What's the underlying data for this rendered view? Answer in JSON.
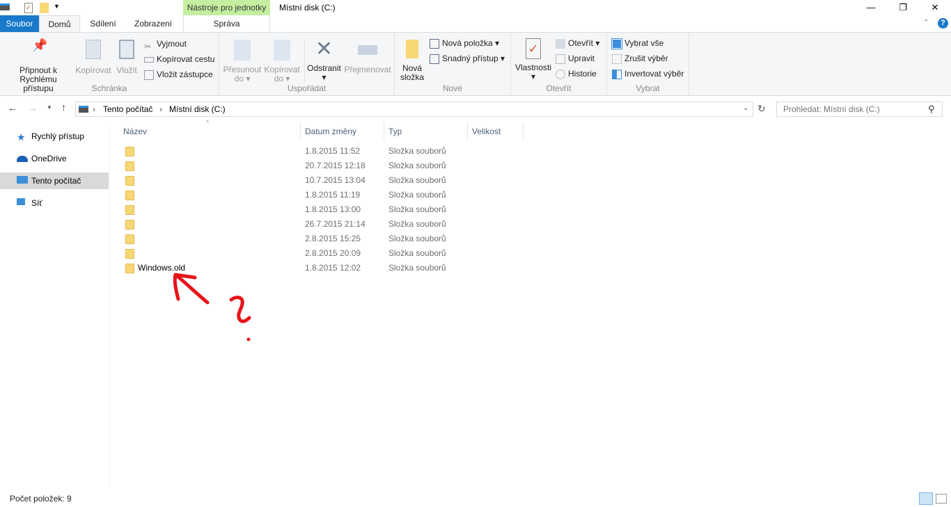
{
  "window": {
    "title": "Místní disk (C:)",
    "context_tab": "Nástroje pro jednotky",
    "minimize": "—",
    "restore": "❐",
    "close": "✕"
  },
  "tabs": {
    "file": "Soubor",
    "home": "Domů",
    "share": "Sdílení",
    "view": "Zobrazení",
    "manage": "Správa"
  },
  "ribbon": {
    "clipboard": {
      "label": "Schránka",
      "pin": "Připnout k",
      "pin2": "Rychlému přístupu",
      "copy": "Kopírovat",
      "paste": "Vložit",
      "cut": "Vyjmout",
      "copy_path": "Kopírovat cestu",
      "paste_shortcut": "Vložit zástupce"
    },
    "organize": {
      "label": "Uspořádat",
      "move": "Přesunout",
      "move2": "do",
      "copy": "Kopírovat",
      "copy2": "do",
      "delete": "Odstranit",
      "rename": "Přejmenovat"
    },
    "new": {
      "label": "Nové",
      "new_folder": "Nová",
      "new_folder2": "složka",
      "new_item": "Nová položka",
      "easy_access": "Snadný přístup"
    },
    "open": {
      "label": "Otevřít",
      "properties": "Vlastnosti",
      "open": "Otevřít",
      "edit": "Upravit",
      "history": "Historie"
    },
    "select": {
      "label": "Vybrat",
      "all": "Vybrat vše",
      "none": "Zrušit výběr",
      "invert": "Invertovat výběr"
    }
  },
  "address": {
    "crumbs": [
      "Tento počítač",
      "Místní disk (C:)"
    ],
    "search_placeholder": "Prohledat: Místní disk (C:)"
  },
  "nav": [
    {
      "label": "Rychlý přístup",
      "color": "#2b7cd3"
    },
    {
      "label": "OneDrive",
      "color": "#1a5fb4"
    },
    {
      "label": "Tento počítač",
      "color": "#3b8fd8"
    },
    {
      "label": "Síť",
      "color": "#3b8fd8"
    }
  ],
  "columns": {
    "name": "Název",
    "date": "Datum změny",
    "type": "Typ",
    "size": "Velikost"
  },
  "files": [
    {
      "name": "",
      "date": "1.8.2015 11:52",
      "type": "Složka souborů"
    },
    {
      "name": "",
      "date": "20.7.2015 12:18",
      "type": "Složka souborů"
    },
    {
      "name": "",
      "date": "10.7.2015 13:04",
      "type": "Složka souborů"
    },
    {
      "name": "",
      "date": "1.8.2015 11:19",
      "type": "Složka souborů"
    },
    {
      "name": "",
      "date": "1.8.2015 13:00",
      "type": "Složka souborů"
    },
    {
      "name": "",
      "date": "26.7.2015 21:14",
      "type": "Složka souborů"
    },
    {
      "name": "",
      "date": "2.8.2015 15:25",
      "type": "Složka souborů"
    },
    {
      "name": "",
      "date": "2.8.2015 20:09",
      "type": "Složka souborů"
    },
    {
      "name": "Windows.old",
      "date": "1.8.2015 12:02",
      "type": "Složka souborů"
    }
  ],
  "status": {
    "count": "Počet položek: 9"
  }
}
